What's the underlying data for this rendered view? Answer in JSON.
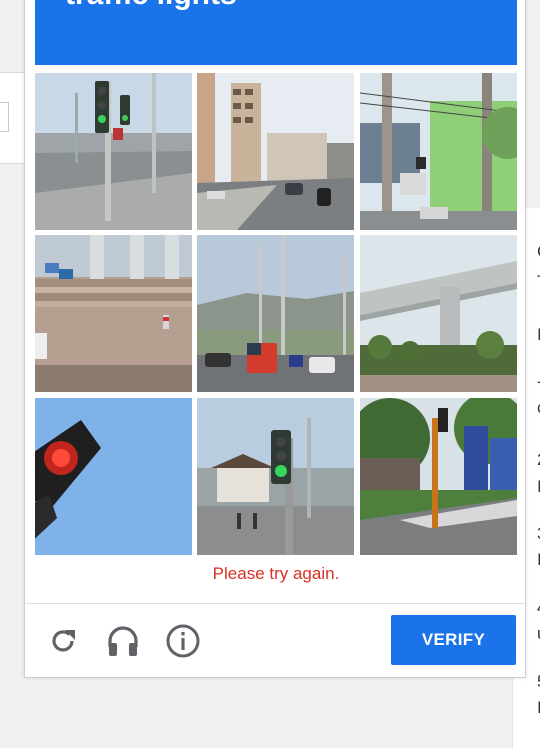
{
  "header": {
    "title": "traffic lights",
    "color": "#1a73e8"
  },
  "tiles": [
    {
      "scene": "traffic-light-street"
    },
    {
      "scene": "road-with-buildings"
    },
    {
      "scene": "utility-poles-green-building"
    },
    {
      "scene": "plaza-steps"
    },
    {
      "scene": "truck-on-road"
    },
    {
      "scene": "overpass"
    },
    {
      "scene": "traffic-light-closeup"
    },
    {
      "scene": "green-traffic-light"
    },
    {
      "scene": "street-corner-sign"
    }
  ],
  "error_text": "Please try again.",
  "error_color": "#d93025",
  "toolbar": {
    "reload_icon": "reload-icon",
    "audio_icon": "headphones-icon",
    "info_icon": "info-icon",
    "verify_label": "VERIFY"
  },
  "background": {
    "side_letters": [
      "C",
      "T",
      "I",
      "-",
      "c",
      "2",
      "I",
      "3",
      "I",
      "4",
      "u",
      "5",
      "I"
    ]
  }
}
